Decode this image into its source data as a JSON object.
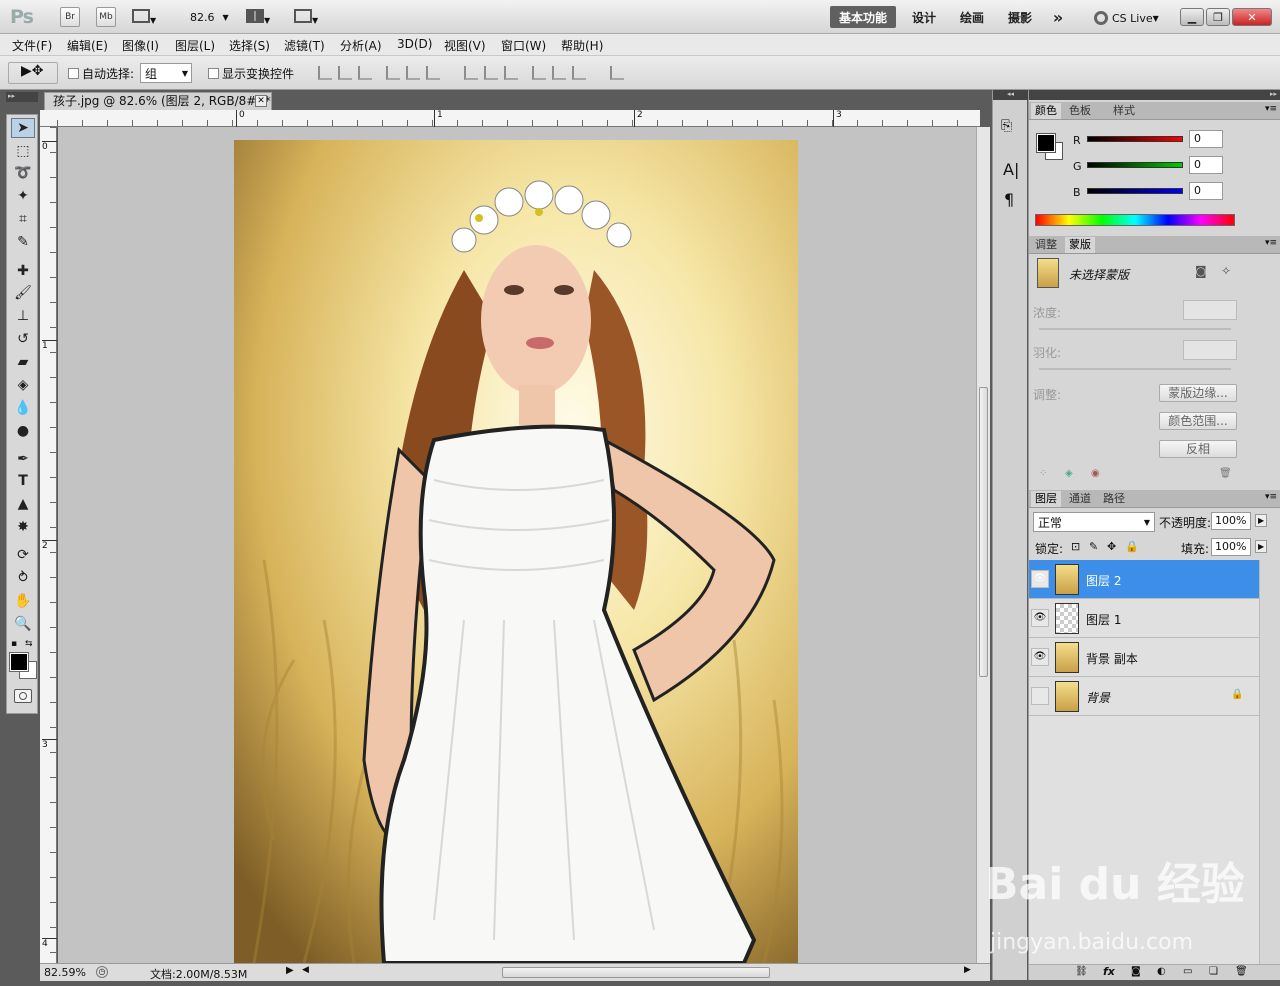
{
  "app": {
    "logo": "Ps",
    "bridge": "Br",
    "minibridge": "Mb",
    "zoom_value": "82.6",
    "workspaces": [
      "基本功能",
      "设计",
      "绘画",
      "摄影"
    ],
    "more": "»",
    "cslive": "CS Live"
  },
  "menu": [
    "文件(F)",
    "编辑(E)",
    "图像(I)",
    "图层(L)",
    "选择(S)",
    "滤镜(T)",
    "分析(A)",
    "3D(D)",
    "视图(V)",
    "窗口(W)",
    "帮助(H)"
  ],
  "options": {
    "auto_select_label": "自动选择:",
    "auto_select_value": "组",
    "show_transform_label": "显示变换控件"
  },
  "document": {
    "tab_title": "孩子.jpg @ 82.6% (图层 2, RGB/8#) *",
    "ruler_top": [
      "0",
      "1",
      "2",
      "3"
    ],
    "ruler_left": [
      "0",
      "1",
      "2",
      "3",
      "4"
    ],
    "status_zoom": "82.59%",
    "status_doc": "文档:2.00M/8.53M"
  },
  "color_panel": {
    "tabs": [
      "颜色",
      "色板",
      "样式"
    ],
    "r_label": "R",
    "g_label": "G",
    "b_label": "B",
    "r": "0",
    "g": "0",
    "b": "0"
  },
  "mask_panel": {
    "tabs": [
      "调整",
      "蒙版"
    ],
    "title": "未选择蒙版",
    "density_label": "浓度:",
    "feather_label": "羽化:",
    "adjust_label": "调整:",
    "btn_edge": "蒙版边缘...",
    "btn_range": "颜色范围...",
    "btn_invert": "反相"
  },
  "layers_panel": {
    "tabs": [
      "图层",
      "通道",
      "路径"
    ],
    "blend_mode": "正常",
    "opacity_label": "不透明度:",
    "opacity": "100%",
    "lock_label": "锁定:",
    "fill_label": "填充:",
    "fill": "100%",
    "layers": [
      {
        "name": "图层 2",
        "selected": true,
        "visible": true
      },
      {
        "name": "图层 1",
        "selected": false,
        "visible": true
      },
      {
        "name": "背景 副本",
        "selected": false,
        "visible": true
      },
      {
        "name": "背景",
        "selected": false,
        "visible": false
      }
    ]
  },
  "watermark": {
    "main": "Bai du 经验",
    "sub": "jingyan.baidu.com"
  }
}
